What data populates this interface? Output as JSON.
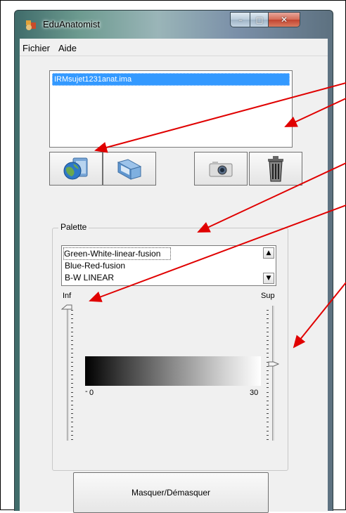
{
  "window": {
    "title": "EduAnatomist",
    "minimize_glyph": "–",
    "maximize_glyph": "□",
    "close_glyph": "✕"
  },
  "menu": {
    "items": [
      {
        "label": "Fichier"
      },
      {
        "label": "Aide"
      }
    ]
  },
  "objects_list": {
    "selected_item": "IRMsujet1231anat.ima"
  },
  "toolbar": {
    "buttons": [
      {
        "icon": "globe-folder-icon"
      },
      {
        "icon": "folder-icon"
      },
      {
        "icon": "camera-icon"
      },
      {
        "icon": "trash-icon"
      }
    ]
  },
  "palette": {
    "group_label": "Palette",
    "items": [
      {
        "label": "Green-White-linear-fusion"
      },
      {
        "label": "Blue-Red-fusion"
      },
      {
        "label": "B-W LINEAR"
      }
    ],
    "scroll_up_glyph": "▲",
    "scroll_down_glyph": "▼",
    "inf_label": "Inf",
    "sup_label": "Sup",
    "range_min": "0",
    "range_max": "30",
    "inf_level": 0.0,
    "sup_level": 0.43
  },
  "actions": {
    "mask_label": "Masquer/Démasquer"
  },
  "colors": {
    "selection": "#3399ff",
    "annotation_arrow": "#e00000",
    "close_button": "#c24430"
  }
}
